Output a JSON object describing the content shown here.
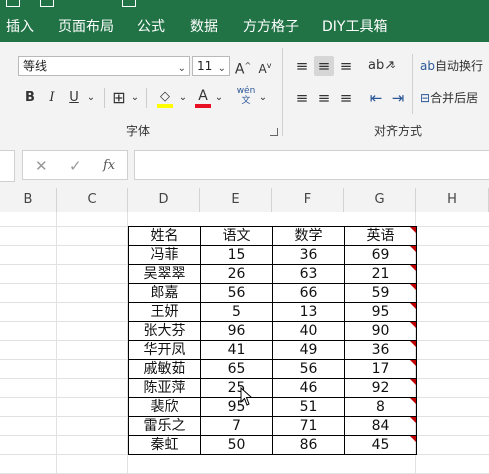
{
  "ribbon_tabs": [
    "插入",
    "页面布局",
    "公式",
    "数据",
    "方方格子",
    "DIY工具箱"
  ],
  "font": {
    "name": "等线",
    "size": "11",
    "group_label": "字体"
  },
  "alignment": {
    "wrap_text": "自动换行",
    "merge_center": "合并后居",
    "group_label": "对齐方式"
  },
  "formula_bar": {
    "fx_label": "fx",
    "cancel": "✕",
    "confirm": "✓",
    "value": ""
  },
  "columns": [
    "B",
    "C",
    "D",
    "E",
    "F",
    "G",
    "H"
  ],
  "table": {
    "headers": [
      "姓名",
      "语文",
      "数学",
      "英语"
    ],
    "rows": [
      [
        "冯菲",
        "15",
        "36",
        "69"
      ],
      [
        "吴翠翠",
        "26",
        "63",
        "21"
      ],
      [
        "郎嘉",
        "56",
        "66",
        "59"
      ],
      [
        "王妍",
        "5",
        "13",
        "95"
      ],
      [
        "张大芬",
        "96",
        "40",
        "90"
      ],
      [
        "华开凤",
        "41",
        "49",
        "36"
      ],
      [
        "戚敏茹",
        "65",
        "56",
        "17"
      ],
      [
        "陈亚萍",
        "25",
        "46",
        "92"
      ],
      [
        "裴欣",
        "95",
        "51",
        "8"
      ],
      [
        "雷乐之",
        "7",
        "71",
        "84"
      ],
      [
        "秦虹",
        "50",
        "86",
        "45"
      ]
    ]
  },
  "colors": {
    "title_bar": "#217346",
    "comment_marker": "#c00000",
    "font_color": "#e81123",
    "highlight": "#ffff00"
  }
}
